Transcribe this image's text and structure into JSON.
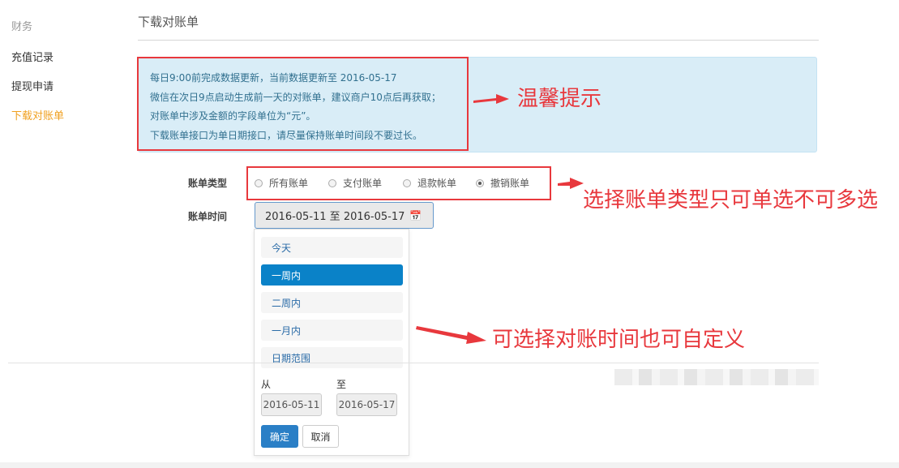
{
  "sidebar": {
    "category": "财务",
    "items": [
      {
        "label": "充值记录"
      },
      {
        "label": "提现申请"
      },
      {
        "label": "下载对账单"
      }
    ]
  },
  "page": {
    "title": "下载对账单"
  },
  "notice": {
    "lines": [
      "每日9:00前完成数据更新，当前数据更新至 2016-05-17",
      "微信在次日9点启动生成前一天的对账单，建议商户10点后再获取；",
      "对账单中涉及金额的字段单位为“元”。",
      "下载账单接口为单日期接口，请尽量保持账单时间段不要过长。"
    ]
  },
  "form": {
    "bill_type_label": "账单类型",
    "bill_types": [
      {
        "label": "所有账单",
        "checked": false
      },
      {
        "label": "支付账单",
        "checked": false
      },
      {
        "label": "退款帐单",
        "checked": false
      },
      {
        "label": "撤销账单",
        "checked": true
      }
    ],
    "bill_time_label": "账单时间",
    "date_range_value": "2016-05-11 至 2016-05-17",
    "calendar_icon": "calendar-icon"
  },
  "dropdown": {
    "options": [
      {
        "label": "今天",
        "active": false
      },
      {
        "label": "一周内",
        "active": true
      },
      {
        "label": "二周内",
        "active": false
      },
      {
        "label": "一月内",
        "active": false
      },
      {
        "label": "日期范围",
        "active": false
      }
    ],
    "from_label": "从",
    "to_label": "至",
    "from_value": "2016-05-11",
    "to_value": "2016-05-17",
    "confirm_label": "确定",
    "cancel_label": "取消"
  },
  "annotations": {
    "tip": "温馨提示",
    "single_select": "选择账单类型只可单选不可多选",
    "custom_time": "可选择对账时间也可自定义"
  },
  "colors": {
    "accent": "#0a82c8",
    "active_sidebar": "#f0a020",
    "annotation_red": "#e8383d",
    "notice_bg": "#d9edf7"
  }
}
